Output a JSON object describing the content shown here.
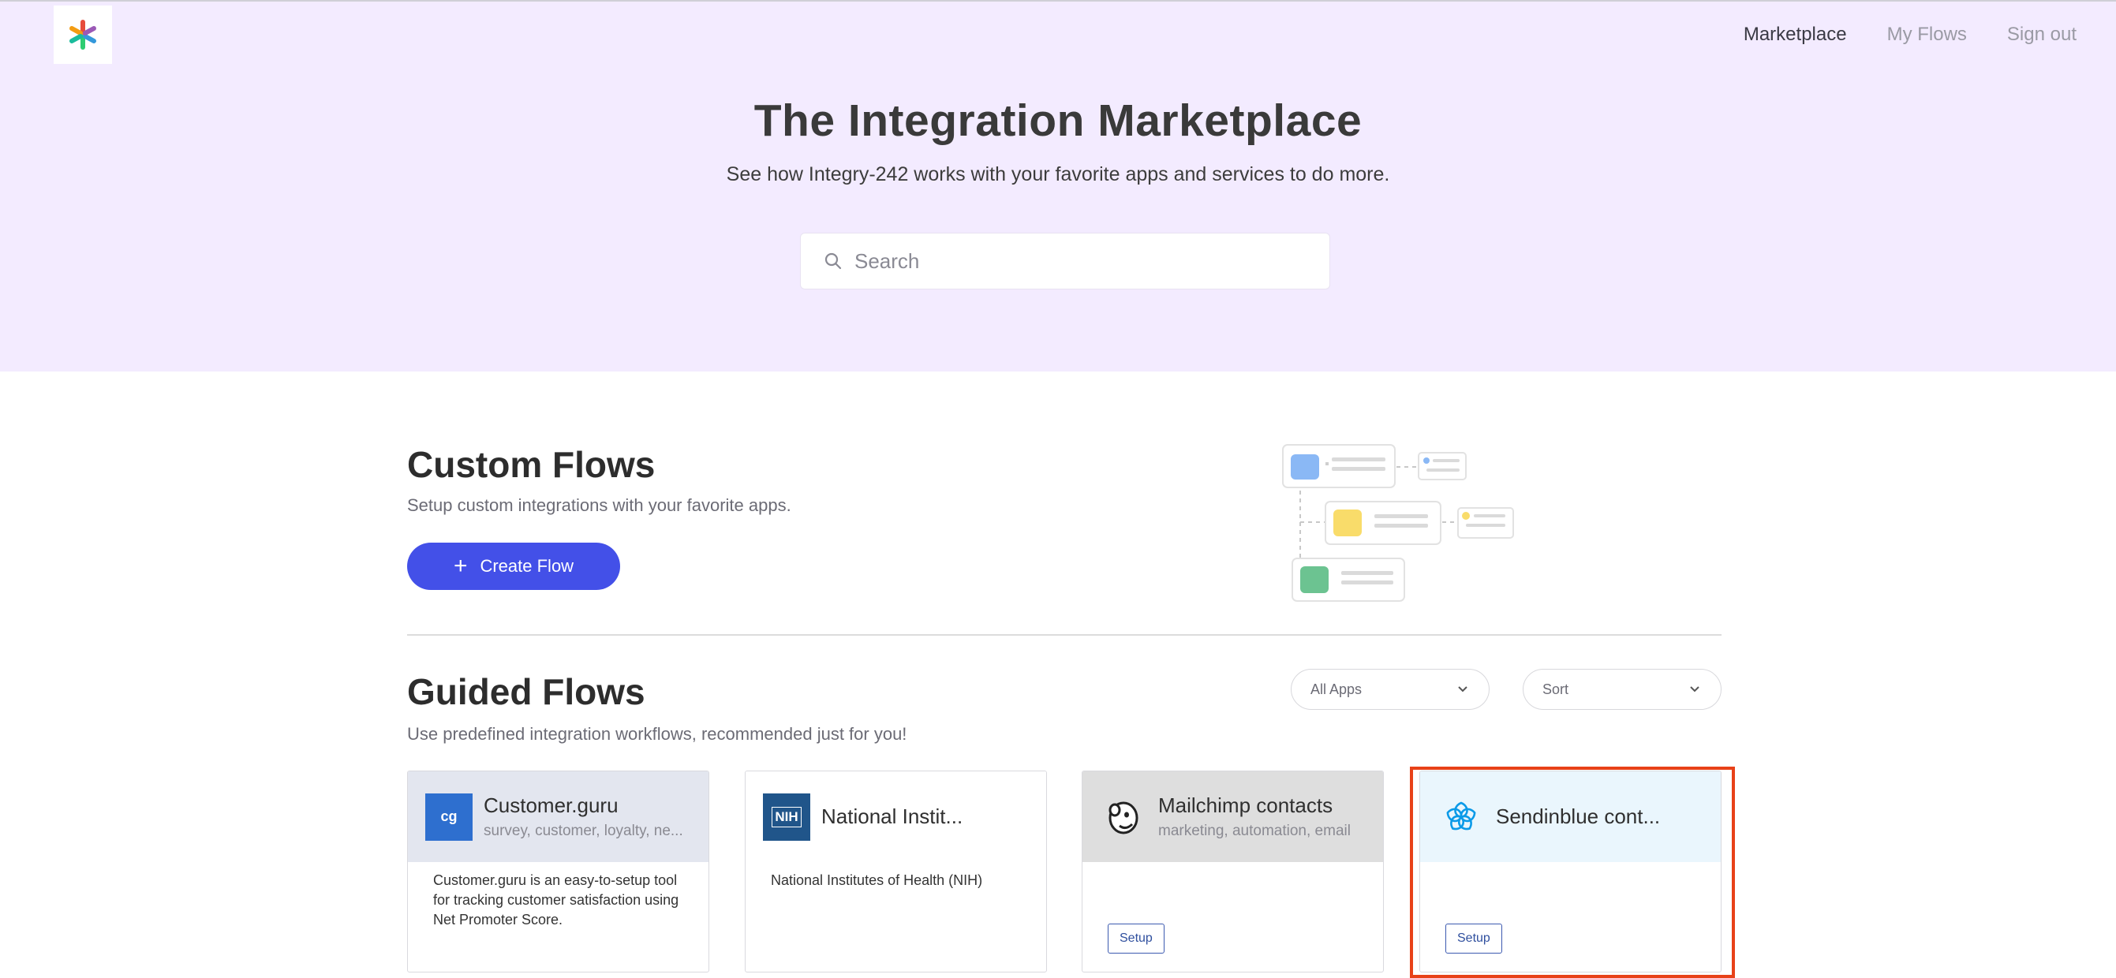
{
  "nav": {
    "items": [
      {
        "label": "Marketplace",
        "active": true
      },
      {
        "label": "My Flows",
        "active": false
      },
      {
        "label": "Sign out",
        "active": false
      }
    ]
  },
  "hero": {
    "title": "The Integration Marketplace",
    "subtitle": "See how Integry-242 works with your favorite apps and services to do more.",
    "search_placeholder": "Search"
  },
  "custom_flows": {
    "title": "Custom Flows",
    "subtitle": "Setup custom integrations with your favorite apps.",
    "create_label": "Create Flow"
  },
  "guided_flows": {
    "title": "Guided Flows",
    "subtitle": "Use predefined integration workflows, recommended just for you!",
    "filter_apps": "All Apps",
    "filter_sort": "Sort"
  },
  "cards": [
    {
      "title": "Customer.guru",
      "tags": "survey, customer, loyalty, ne...",
      "description": "Customer.guru is an easy-to-setup tool for tracking customer satisfaction using Net Promoter Score.",
      "icon_text": "cg",
      "header_color": "#e3e6ef"
    },
    {
      "title": "National Instit...",
      "tags": "",
      "description": "National Institutes of Health (NIH)",
      "icon_text": "NIH",
      "header_color": "#ffffff"
    },
    {
      "title": "Mailchimp contacts",
      "tags": "marketing, automation, email",
      "setup_label": "Setup",
      "header_color": "#dedede"
    },
    {
      "title": "Sendinblue cont...",
      "tags": "",
      "setup_label": "Setup",
      "header_color": "#eaf6fd"
    }
  ]
}
